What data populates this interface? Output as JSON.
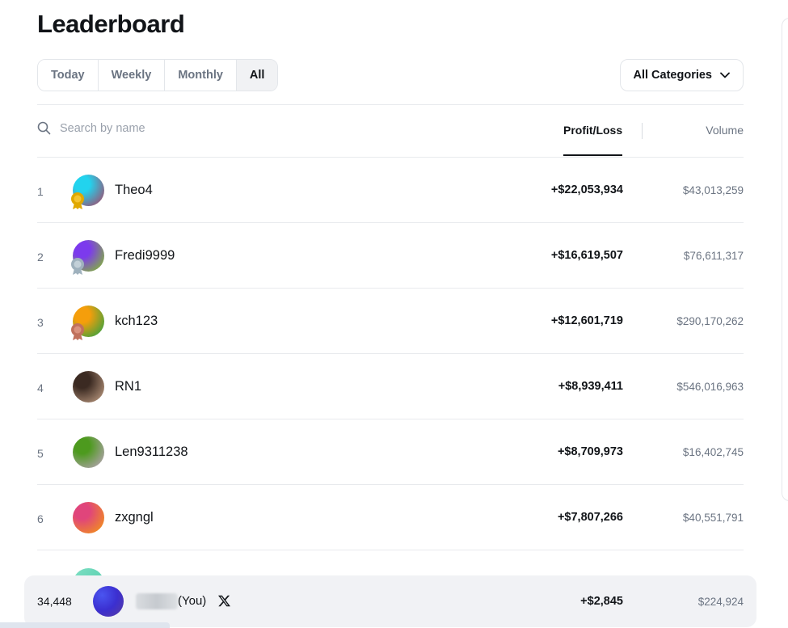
{
  "header": {
    "title": "Leaderboard"
  },
  "tabs": [
    {
      "label": "Today",
      "active": false
    },
    {
      "label": "Weekly",
      "active": false
    },
    {
      "label": "Monthly",
      "active": false
    },
    {
      "label": "All",
      "active": true
    }
  ],
  "category_filter": {
    "label": "All Categories",
    "icon": "chevron-down-icon"
  },
  "search": {
    "placeholder": "Search by name",
    "value": "",
    "icon": "search-icon"
  },
  "columns": {
    "profit_loss": "Profit/Loss",
    "volume": "Volume",
    "active_sort": "profit_loss"
  },
  "rows": [
    {
      "rank": "1",
      "name": "Theo4",
      "profit_loss": "+$22,053,934",
      "volume": "$43,013,259",
      "medal": "gold",
      "avatar_colors": [
        "#22d3ee",
        "#b5365a"
      ]
    },
    {
      "rank": "2",
      "name": "Fredi9999",
      "profit_loss": "+$16,619,507",
      "volume": "$76,611,317",
      "medal": "silver",
      "avatar_colors": [
        "#7c3aed",
        "#84cc16"
      ]
    },
    {
      "rank": "3",
      "name": "kch123",
      "profit_loss": "+$12,601,719",
      "volume": "$290,170,262",
      "medal": "bronze",
      "avatar_colors": [
        "#f59e0b",
        "#16a34a"
      ]
    },
    {
      "rank": "4",
      "name": "RN1",
      "profit_loss": "+$8,939,411",
      "volume": "$546,016,963",
      "medal": "none",
      "avatar_colors": [
        "#3b2a22",
        "#c9a58a"
      ]
    },
    {
      "rank": "5",
      "name": "Len9311238",
      "profit_loss": "+$8,709,973",
      "volume": "$16,402,745",
      "medal": "none",
      "avatar_colors": [
        "#4d9a1e",
        "#c4a3c8"
      ]
    },
    {
      "rank": "6",
      "name": "zxgngl",
      "profit_loss": "+$7,807,266",
      "volume": "$40,551,791",
      "medal": "none",
      "avatar_colors": [
        "#e0457b",
        "#f59e0b"
      ]
    }
  ],
  "current_user": {
    "rank": "34,448",
    "label": "(You)",
    "profit_loss": "+$2,845",
    "volume": "$224,924",
    "social_icon": "x-logo-icon"
  },
  "colors": {
    "gold": "#e0a800",
    "silver": "#9fb1bd",
    "bronze": "#c0715c",
    "text": "#111418",
    "muted": "#6b7482"
  }
}
